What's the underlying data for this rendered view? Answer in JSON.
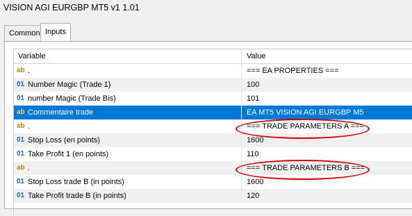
{
  "window": {
    "title": "VISION AGI EURGBP MT5 v1 1.01"
  },
  "tabs": [
    {
      "label": "Common"
    },
    {
      "label": "Inputs"
    }
  ],
  "grid": {
    "headers": {
      "variable": "Variable",
      "value": "Value"
    },
    "rows": [
      {
        "type": "ab",
        "icon": "ab",
        "name": ".",
        "value": "=== EA PROPERTIES ==="
      },
      {
        "type": "num",
        "icon": "01",
        "name": "Number Magic (Trade 1)",
        "value": "100"
      },
      {
        "type": "num",
        "icon": "01",
        "name": "number Magic (Trade Bis)",
        "value": "101"
      },
      {
        "type": "ab",
        "icon": "ab",
        "name": "Commentaire trade",
        "value": "EA MT5 VISION AGI EURGBP M5"
      },
      {
        "type": "ab",
        "icon": "ab",
        "name": ".",
        "value": "=== TRADE PARAMETERS A ==="
      },
      {
        "type": "num",
        "icon": "01",
        "name": "Stop Loss (en points)",
        "value": "1600"
      },
      {
        "type": "num",
        "icon": "01",
        "name": "Take Profit 1 (en points)",
        "value": "110"
      },
      {
        "type": "ab",
        "icon": "ab",
        "name": ".",
        "value": "=== TRADE PARAMETERS B ==="
      },
      {
        "type": "num",
        "icon": "01",
        "name": "Stop Loss trade B (in points)",
        "value": "1600"
      },
      {
        "type": "num",
        "icon": "01",
        "name": "Take Profit trade B (in points)",
        "value": "120"
      }
    ]
  },
  "annotation_color": "#d40000",
  "selection_color": "#0078d7"
}
